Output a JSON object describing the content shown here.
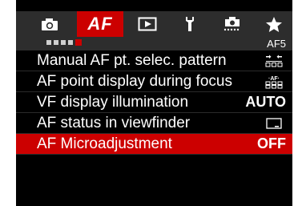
{
  "tabs": [
    {
      "icon": "camera-icon"
    },
    {
      "label": "AF"
    },
    {
      "icon": "playback-icon"
    },
    {
      "icon": "wrench-icon"
    },
    {
      "icon": "custom-function-camera-icon"
    },
    {
      "icon": "star-icon"
    }
  ],
  "page_indicator": {
    "dots": 5,
    "active_index": 4,
    "label": "AF5"
  },
  "menu": {
    "items": [
      {
        "label": "Manual AF pt. selec. pattern",
        "value_icon": "af-point-pattern-icon",
        "selected": false
      },
      {
        "label": "AF point display during focus",
        "value_icon": "af-point-display-icon",
        "selected": false
      },
      {
        "label": "VF display illumination",
        "value": "AUTO",
        "selected": false
      },
      {
        "label": "AF status in viewfinder",
        "value_icon": "viewfinder-status-icon",
        "selected": false
      },
      {
        "label": "AF Microadjustment",
        "value": "OFF",
        "selected": true
      }
    ]
  },
  "colors": {
    "accent": "#cc0000",
    "bar": "#2d2d2d",
    "background": "#000000"
  }
}
